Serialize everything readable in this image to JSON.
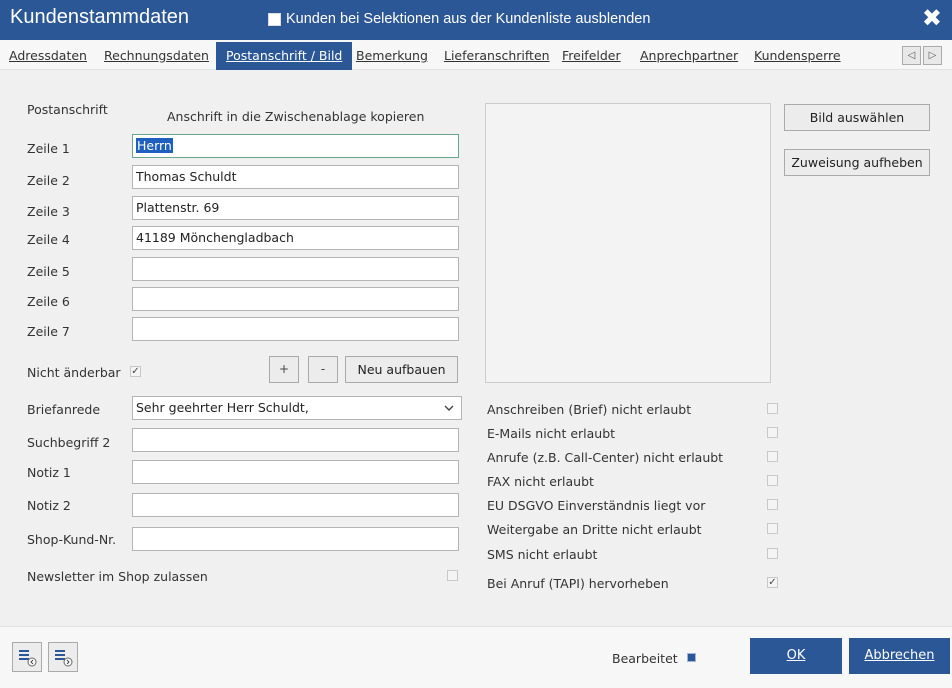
{
  "window": {
    "title": "Kundenstammdaten",
    "hide_label": "Kunden bei Selektionen aus der Kundenliste ausblenden",
    "close": "✖"
  },
  "tabs": [
    "Adressdaten",
    "Rechnungsdaten",
    "Postanschrift / Bild",
    "Bemerkung",
    "Lieferanschriften",
    "Freifelder",
    "Anprechpartner",
    "Kundensperre"
  ],
  "nav": {
    "prev": "◁",
    "next": "▷"
  },
  "postanschrift": {
    "section_label": "Postanschrift",
    "copy_link": "Anschrift in die Zwischenablage kopieren",
    "lines": [
      {
        "label": "Zeile 1",
        "value": "Herrn"
      },
      {
        "label": "Zeile 2",
        "value": "Thomas Schuldt"
      },
      {
        "label": "Zeile 3",
        "value": "Plattenstr. 69"
      },
      {
        "label": "Zeile 4",
        "value": "41189 Mönchengladbach"
      },
      {
        "label": "Zeile 5",
        "value": ""
      },
      {
        "label": "Zeile 6",
        "value": ""
      },
      {
        "label": "Zeile 7",
        "value": ""
      }
    ],
    "locked_label": "Nicht änderbar",
    "locked_check": "✓",
    "plus": "+",
    "minus": "-",
    "rebuild": "Neu aufbauen"
  },
  "fields": {
    "briefanrede_label": "Briefanrede",
    "briefanrede_value": "Sehr geehrter Herr Schuldt,",
    "suchbegriff_label": "Suchbegriff 2",
    "suchbegriff_value": "",
    "notiz1_label": "Notiz 1",
    "notiz1_value": "",
    "notiz2_label": "Notiz 2",
    "notiz2_value": "",
    "shop_label": "Shop-Kund-Nr.",
    "shop_value": "",
    "newsletter_label": "Newsletter im Shop zulassen"
  },
  "image": {
    "select_button": "Bild auswählen",
    "unassign_button": "Zuweisung aufheben"
  },
  "permissions": [
    {
      "label": "Anschreiben (Brief) nicht erlaubt",
      "checked": ""
    },
    {
      "label": "E-Mails nicht erlaubt",
      "checked": ""
    },
    {
      "label": "Anrufe (z.B. Call-Center) nicht erlaubt",
      "checked": ""
    },
    {
      "label": "FAX nicht erlaubt",
      "checked": ""
    },
    {
      "label": "EU DSGVO Einverständnis liegt vor",
      "checked": ""
    },
    {
      "label": "Weitergabe an Dritte nicht erlaubt",
      "checked": ""
    },
    {
      "label": "SMS nicht erlaubt",
      "checked": ""
    },
    {
      "label": "Bei Anruf (TAPI) hervorheben",
      "checked": "✓"
    }
  ],
  "footer": {
    "edited_label": "Bearbeitet",
    "ok": "OK",
    "cancel": "Abbrechen"
  },
  "colors": {
    "accent": "#2b5797",
    "focus": "#6aa58d",
    "selection": "#1f5fbf"
  }
}
